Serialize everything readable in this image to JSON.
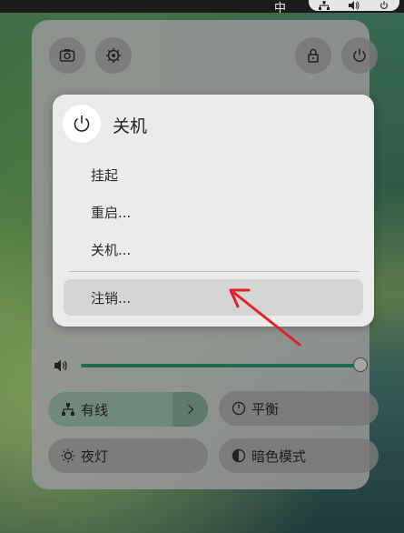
{
  "topbar": {
    "input_method": "中",
    "icons": [
      "network-icon",
      "volume-icon",
      "power-icon"
    ]
  },
  "panel": {
    "top_buttons": [
      "screenshot-icon",
      "settings-icon",
      "lock-icon",
      "power-icon"
    ]
  },
  "power_menu": {
    "title": "关机",
    "items": [
      {
        "label": "挂起"
      },
      {
        "label": "重启..."
      },
      {
        "label": "关机..."
      },
      {
        "label": "注销..."
      }
    ],
    "active_index": 3
  },
  "volume": {
    "level": 1.0
  },
  "toggles": {
    "wired": {
      "label": "有线",
      "on": true
    },
    "balance": {
      "label": "平衡"
    },
    "night_light": {
      "label": "夜灯"
    },
    "dark_mode": {
      "label": "暗色模式"
    }
  },
  "colors": {
    "accent": "#1f6b4f",
    "annotation": "#e0202a"
  }
}
